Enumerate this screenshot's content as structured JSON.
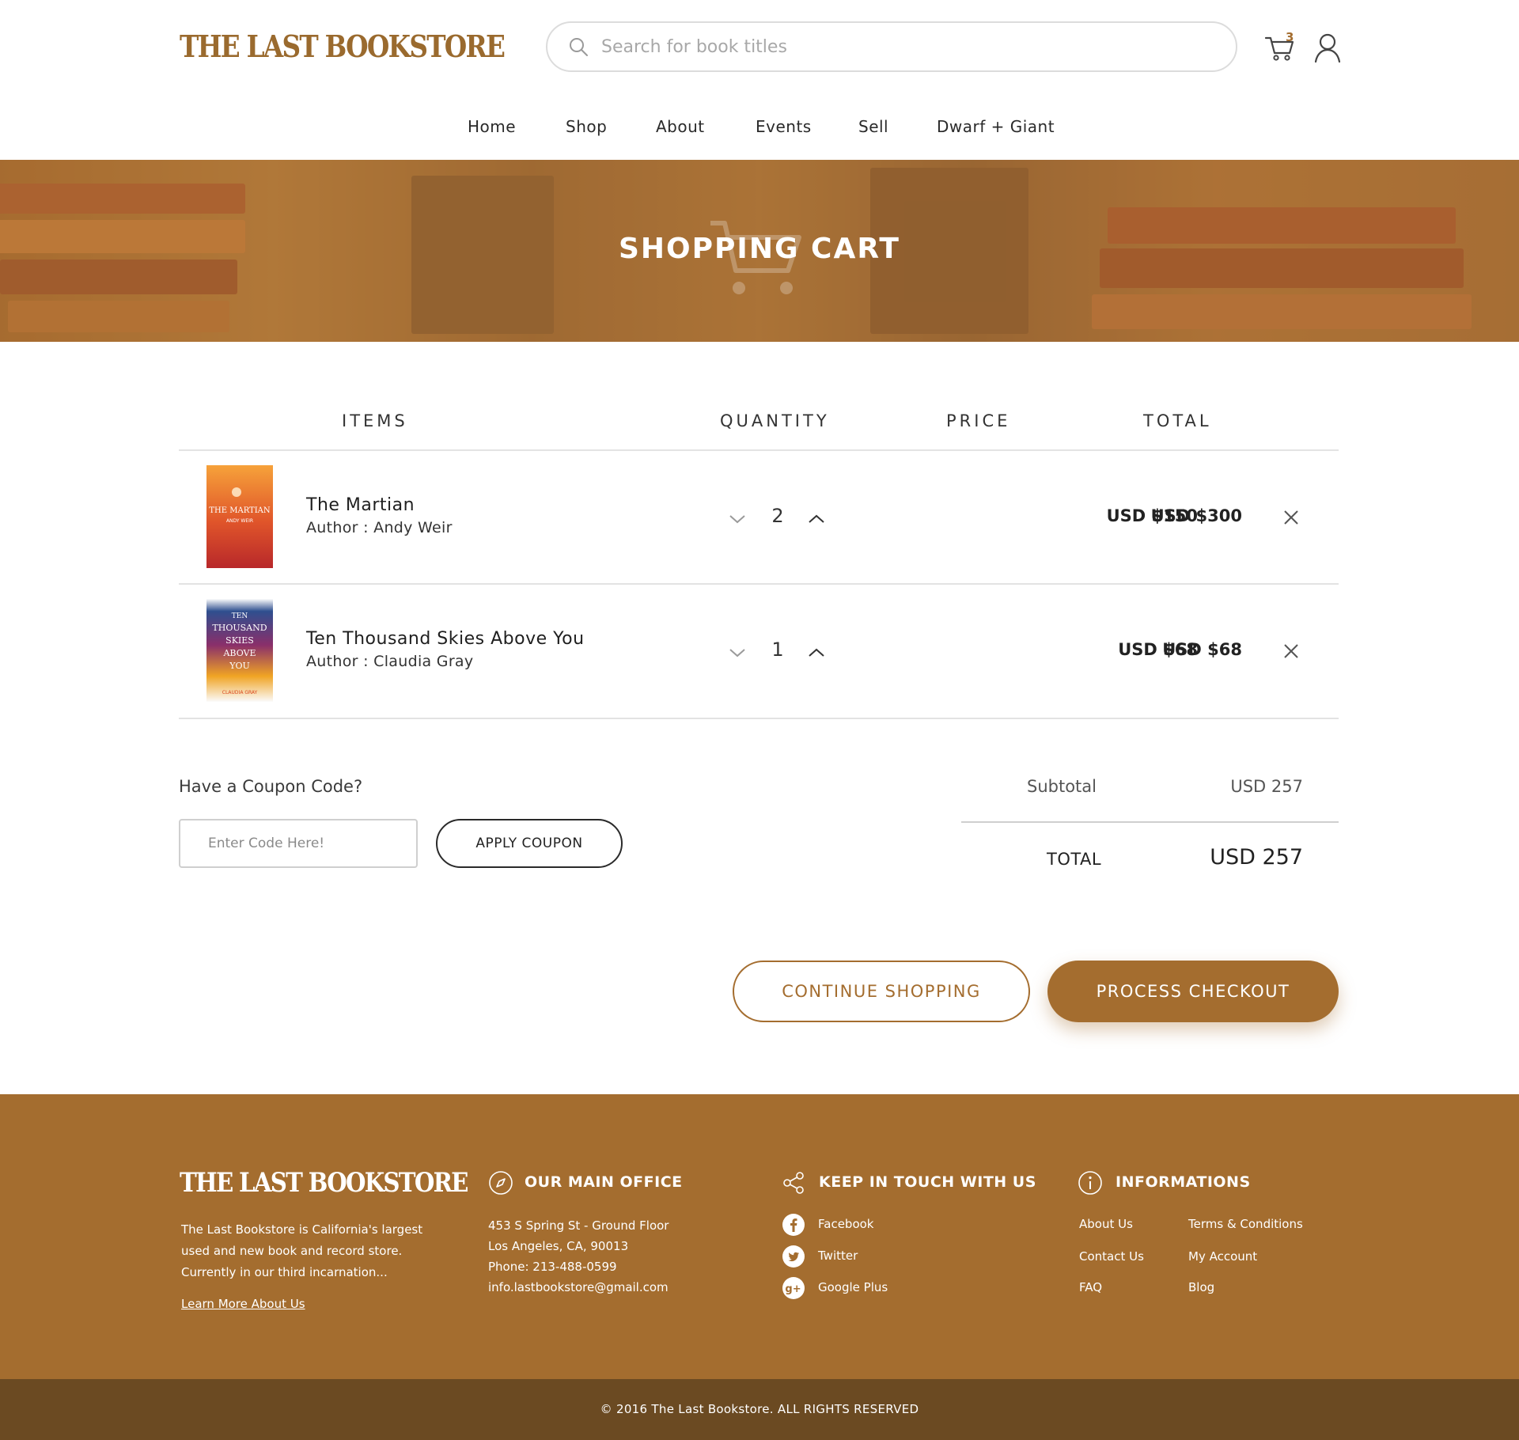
{
  "header": {
    "logo": "THE LAST BOOKSTORE",
    "search_placeholder": "Search for book titles",
    "cart_count": "3"
  },
  "nav": {
    "items": [
      "Home",
      "Shop",
      "About",
      "Events",
      "Sell",
      "Dwarf + Giant"
    ]
  },
  "hero": {
    "title": "SHOPPING CART"
  },
  "cart": {
    "headers": {
      "items": "ITEMS",
      "quantity": "QUANTITY",
      "price": "PRICE",
      "total": "TOTAL"
    },
    "rows": [
      {
        "title": "The Martian",
        "author": "Author : Andy Weir",
        "quantity": "2",
        "price": "USD $150",
        "total": "USD $300",
        "cover_text": [
          "THE MARTIAN",
          "ANDY WEIR"
        ],
        "cover_colors": [
          "#f28a2e",
          "#d9481f",
          "#b8282a"
        ]
      },
      {
        "title": "Ten Thousand Skies Above You",
        "author": "Author : Claudia Gray",
        "quantity": "1",
        "price": "USD $68",
        "total": "USD $68",
        "cover_text": [
          "TEN",
          "THOUSAND",
          "SKIES",
          "ABOVE",
          "YOU",
          "CLAUDIA GRAY"
        ],
        "cover_colors": [
          "#2f4f8f",
          "#8a2f6a",
          "#f0a424"
        ]
      }
    ]
  },
  "coupon": {
    "label": "Have a Coupon Code?",
    "placeholder": "Enter Code Here!",
    "button": "APPLY COUPON"
  },
  "summary": {
    "subtotal_label": "Subtotal",
    "subtotal_value": "USD 257",
    "total_label": "TOTAL",
    "total_value": "USD 257"
  },
  "actions": {
    "continue": "CONTINUE SHOPPING",
    "checkout": "PROCESS CHECKOUT"
  },
  "footer": {
    "logo": "THE LAST BOOKSTORE",
    "about": "The Last Bookstore is California's largest used and new book and record store. Currently in our third incarnation...",
    "learn_more": "Learn More About Us",
    "office": {
      "heading": "OUR MAIN OFFICE",
      "lines": [
        "453 S Spring St - Ground Floor",
        "Los Angeles, CA, 90013",
        "Phone: 213-488-0599",
        "info.lastbookstore@gmail.com"
      ]
    },
    "social": {
      "heading": "KEEP IN TOUCH WITH US",
      "items": [
        {
          "label": "Facebook",
          "icon": "facebook-icon"
        },
        {
          "label": "Twitter",
          "icon": "twitter-icon"
        },
        {
          "label": "Google Plus",
          "icon": "google-plus-icon"
        }
      ]
    },
    "info": {
      "heading": "INFORMATIONS",
      "links": [
        "About Us",
        "Terms & Conditions",
        "Contact Us",
        "My Account",
        "FAQ",
        "Blog"
      ]
    },
    "copyright": "© 2016 The Last Bookstore. ALL RIGHTS RESERVED"
  },
  "colors": {
    "brand": "#a46d2f",
    "brand_dark": "#6b4a22",
    "rule": "#e3e3e3"
  }
}
